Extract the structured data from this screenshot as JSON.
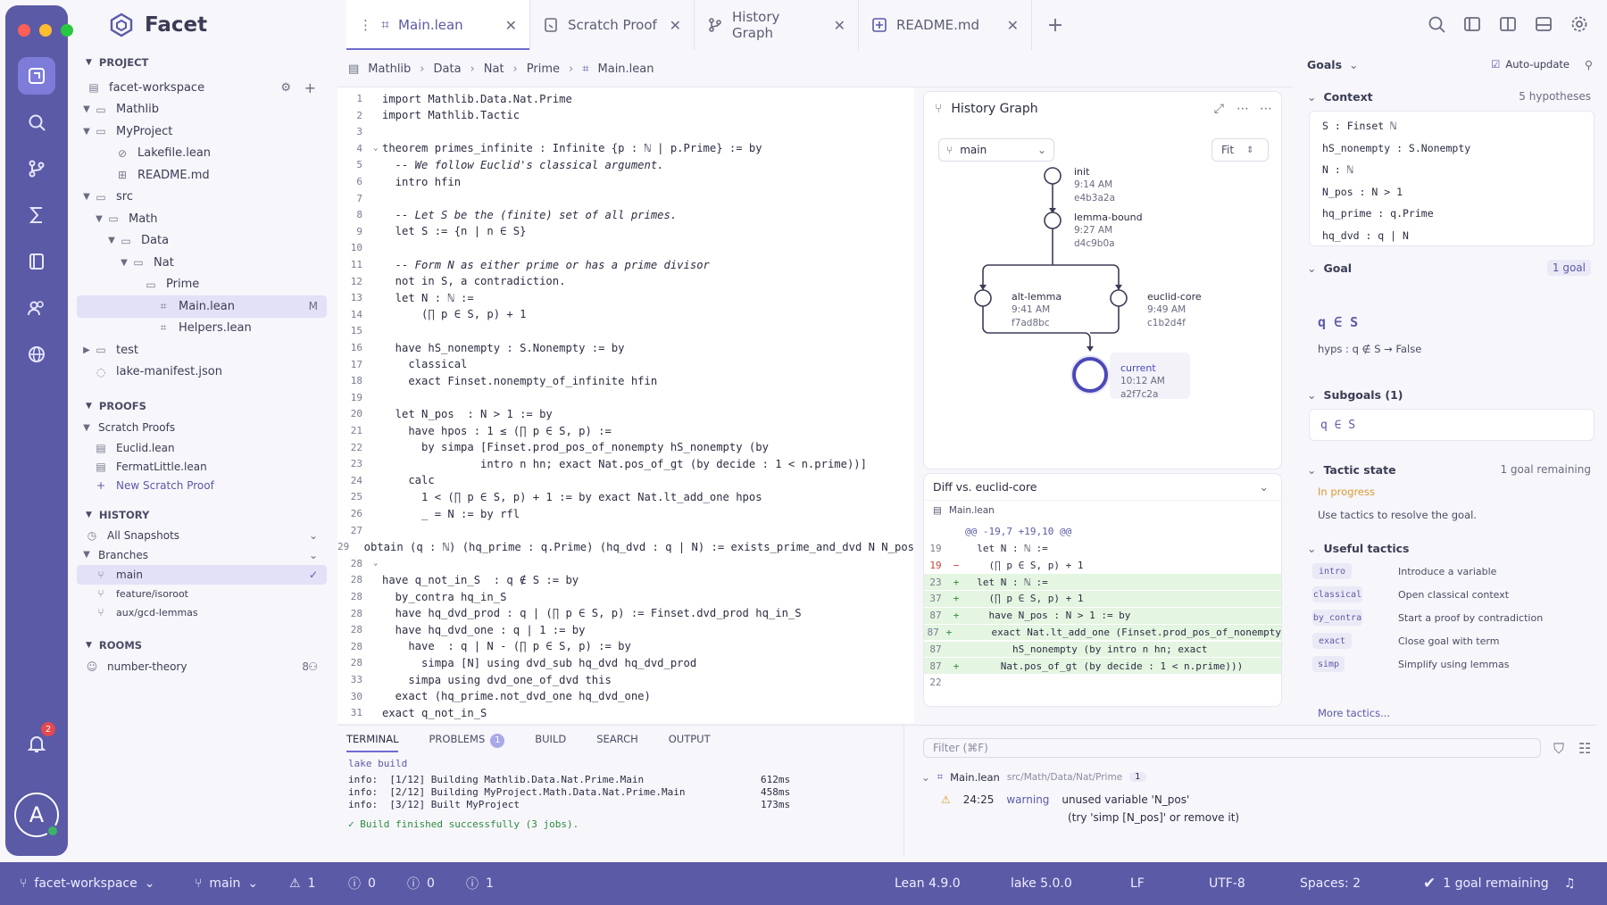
{
  "window": {
    "dots": [
      "#ff5f57",
      "#febc2e",
      "#28c840"
    ],
    "accent": "#5b5aa6"
  },
  "app": {
    "name": "Facet"
  },
  "tabs": [
    {
      "label": "Main.lean"
    },
    {
      "label": "Scratch Proof"
    },
    {
      "label": "History Graph"
    },
    {
      "label": "README.md"
    }
  ],
  "activity": {
    "notification_count": "2",
    "avatar_letter": "A"
  },
  "sidebar": {
    "project_header": "PROJECT",
    "workspace": "facet-workspace",
    "tree": [
      {
        "label": "Mathlib"
      },
      {
        "label": "MyProject"
      },
      {
        "label": "Lakefile.lean"
      },
      {
        "label": "README.md"
      },
      {
        "label": "src"
      },
      {
        "label": "Math"
      },
      {
        "label": "Data"
      },
      {
        "label": "Nat"
      },
      {
        "label": "Prime"
      },
      {
        "label": "Main.lean",
        "badge": "M"
      },
      {
        "label": "Helpers.lean"
      },
      {
        "label": "test"
      },
      {
        "label": "lake-manifest.json"
      }
    ],
    "proofs_header": "PROOFS",
    "scratch_proofs": "Scratch Proofs",
    "proofs": [
      {
        "label": "Euclid.lean"
      },
      {
        "label": "FermatLittle.lean"
      }
    ],
    "new_scratch": "New Scratch Proof",
    "history_header": "HISTORY",
    "all_snapshots": "All Snapshots",
    "branches": "Branches",
    "branch_items": [
      {
        "label": "main"
      },
      {
        "label": "feature/isoroot"
      },
      {
        "label": "aux/gcd-lemmas"
      }
    ],
    "rooms_header": "ROOMS",
    "room": {
      "label": "number-theory",
      "count": "8"
    }
  },
  "breadcrumb": [
    "Mathlib",
    "Data",
    "Nat",
    "Prime",
    "Main.lean"
  ],
  "editor_lines": [
    {
      "n": "1",
      "t": "import Mathlib.Data.Nat.Prime"
    },
    {
      "n": "2",
      "t": "import Mathlib.Tactic"
    },
    {
      "n": "3",
      "t": ""
    },
    {
      "n": "4",
      "t": "theorem primes_infinite : Infinite {p : ℕ | p.Prime} := by"
    },
    {
      "n": "5",
      "t": "  -- We follow Euclid's classical argument."
    },
    {
      "n": "6",
      "t": "  intro hfin"
    },
    {
      "n": "7",
      "t": ""
    },
    {
      "n": "8",
      "t": "  -- Let S be the (finite) set of all primes."
    },
    {
      "n": "9",
      "t": "  let S := {n | n ∈ S}"
    },
    {
      "n": "10",
      "t": ""
    },
    {
      "n": "11",
      "t": "  -- Form N as either prime or has a prime divisor"
    },
    {
      "n": "12",
      "t": "  not in S, a contradiction."
    },
    {
      "n": "13",
      "t": "  let N : ℕ :="
    },
    {
      "n": "14",
      "t": "      (∏ p ∈ S, p) + 1"
    },
    {
      "n": "15",
      "t": ""
    },
    {
      "n": "16",
      "t": "  have hS_nonempty : S.Nonempty := by"
    },
    {
      "n": "17",
      "t": "    classical"
    },
    {
      "n": "18",
      "t": "    exact Finset.nonempty_of_infinite hfin"
    },
    {
      "n": "19",
      "t": ""
    },
    {
      "n": "20",
      "t": "  let N_pos  : N > 1 := by"
    },
    {
      "n": "21",
      "t": "    have hpos : 1 ≤ (∏ p ∈ S, p) :="
    },
    {
      "n": "22",
      "t": "      by simpa [Finset.prod_pos_of_nonempty hS_nonempty (by"
    },
    {
      "n": "23",
      "t": "               intro n hn; exact Nat.pos_of_gt (by decide : 1 < n.prime))]"
    },
    {
      "n": "24",
      "t": "    calc"
    },
    {
      "n": "25",
      "t": "      1 < (∏ p ∈ S, p) + 1 := by exact Nat.lt_add_one hpos"
    },
    {
      "n": "26",
      "t": "      _ = N := by rfl"
    },
    {
      "n": "27",
      "t": ""
    },
    {
      "n": "29",
      "t": "obtain (q : ℕ) (hq_prime : q.Prime) (hq_dvd : q | N) := exists_prime_and_dvd N N_pos"
    },
    {
      "n": "28",
      "t": ""
    },
    {
      "n": "28",
      "t": "have q_not_in_S  : q ∉ S := by"
    },
    {
      "n": "28",
      "t": "  by_contra hq_in_S"
    },
    {
      "n": "28",
      "t": "  have hq_dvd_prod : q | (∏ p ∈ S, p) := Finset.dvd_prod hq_in_S"
    },
    {
      "n": "28",
      "t": "  have hq_dvd_one : q | 1 := by"
    },
    {
      "n": "28",
      "t": "    have  : q | N - (∏ p ∈ S, p) := by"
    },
    {
      "n": "28",
      "t": "      simpa [N] using dvd_sub hq_dvd hq_dvd_prod"
    },
    {
      "n": "33",
      "t": "    simpa using dvd_one_of_dvd this"
    },
    {
      "n": "30",
      "t": "  exact (hq_prime.not_dvd_one hq_dvd_one)"
    },
    {
      "n": "31",
      "t": "exact q_not_in_S"
    }
  ],
  "history_graph": {
    "title": "History Graph",
    "branch": "main",
    "fit": "Fit",
    "nodes": [
      {
        "label": "init",
        "time": "9:14 AM",
        "hash": "e4b3a2a"
      },
      {
        "label": "lemma-bound",
        "time": "9:27 AM",
        "hash": "d4c9b0a"
      },
      {
        "label": "alt-lemma",
        "time": "9:41 AM",
        "hash": "f7ad8bc"
      },
      {
        "label": "euclid-core",
        "time": "9:49 AM",
        "hash": "c1b2d4f"
      },
      {
        "label": "current",
        "time": "10:12 AM",
        "hash": "a2f7c2a"
      }
    ]
  },
  "diff": {
    "title": "Diff vs. euclid-core",
    "file": "Main.lean",
    "lines": [
      {
        "n": "",
        "s": "",
        "t": "@@ -19,7 +19,10 @@",
        "k": "hunk"
      },
      {
        "n": "19",
        "s": "",
        "t": "  let N : ℕ :=",
        "k": "ctx"
      },
      {
        "n": "19",
        "s": "−",
        "t": "    (∏ p ∈ S, p) + 1",
        "k": "del"
      },
      {
        "n": "23",
        "s": "+",
        "t": "  let N : ℕ :=",
        "k": "add"
      },
      {
        "n": "37",
        "s": "+",
        "t": "    (∏ p ∈ S, p) + 1",
        "k": "add"
      },
      {
        "n": "87",
        "s": "+",
        "t": "    have N_pos : N > 1 := by",
        "k": "add"
      },
      {
        "n": "87",
        "s": "+",
        "t": "      exact Nat.lt_add_one (Finset.prod_pos_of_nonempty",
        "k": "add"
      },
      {
        "n": "87",
        "s": "",
        "t": "        hS_nonempty (by intro n hn; exact",
        "k": "add"
      },
      {
        "n": "87",
        "s": "+",
        "t": "      Nat.pos_of_gt (by decide : 1 < n.prime)))",
        "k": "add"
      },
      {
        "n": "22",
        "s": "",
        "t": "",
        "k": "ctx"
      }
    ]
  },
  "goals": {
    "title": "Goals",
    "auto_update": "Auto-update",
    "context_title": "Context",
    "hyp_count": "5 hypotheses",
    "hypotheses": [
      "S : Finset ℕ",
      "hS_nonempty : S.Nonempty",
      "N : ℕ",
      "N_pos : N > 1",
      "hq_prime : q.Prime",
      "hq_dvd : q | N"
    ],
    "goal_title": "Goal",
    "goal_count": "1 goal",
    "goal": "q ∈ S",
    "goal_hyps": "hyps : q ∉ S → False",
    "subgoals_title": "Subgoals (1)",
    "subgoal": "q ∈ S",
    "tactic_title": "Tactic state",
    "tactic_remaining": "1 goal remaining",
    "tactic_status": "In progress",
    "tactic_hint": "Use tactics to resolve the goal.",
    "useful_title": "Useful tactics",
    "tactics": [
      {
        "name": "intro",
        "desc": "Introduce a variable"
      },
      {
        "name": "classical",
        "desc": "Open classical context"
      },
      {
        "name": "by_contra",
        "desc": "Start a proof by contradiction"
      },
      {
        "name": "exact",
        "desc": "Close goal with term"
      },
      {
        "name": "simp",
        "desc": "Simplify using lemmas"
      }
    ],
    "more": "More tactics..."
  },
  "bottom": {
    "tabs": [
      "TERMINAL",
      "PROBLEMS",
      "BUILD",
      "SEARCH",
      "OUTPUT"
    ],
    "problems_count": "1",
    "terminal": [
      {
        "t": "lake build",
        "ms": ""
      },
      {
        "t": "info:  [1/12] Building Mathlib.Data.Nat.Prime.Main",
        "ms": "612ms"
      },
      {
        "t": "info:  [2/12] Building MyProject.Math.Data.Nat.Prime.Main",
        "ms": "458ms"
      },
      {
        "t": "info:  [3/12] Built MyProject",
        "ms": "173ms"
      },
      {
        "t": "✓ Build finished successfully (3 jobs).",
        "ms": ""
      }
    ],
    "filter_placeholder": "Filter (⌘F)",
    "problem_file": "Main.lean",
    "problem_path": "src/Math/Data/Nat/Prime",
    "problem_file_count": "1",
    "problem": {
      "loc": "24:25",
      "sev": "warning",
      "msg": "unused variable 'N_pos'",
      "hint": "(try 'simp [N_pos]' or remove it)"
    }
  },
  "status": {
    "workspace": "facet-workspace",
    "branch": "main",
    "warnings": "1",
    "errors": "0",
    "infos": "0",
    "hints": "1",
    "lean": "Lean 4.9.0",
    "lake": "lake 5.0.0",
    "eol": "LF",
    "encoding": "UTF-8",
    "spaces": "Spaces: 2",
    "goals": "1 goal remaining"
  }
}
